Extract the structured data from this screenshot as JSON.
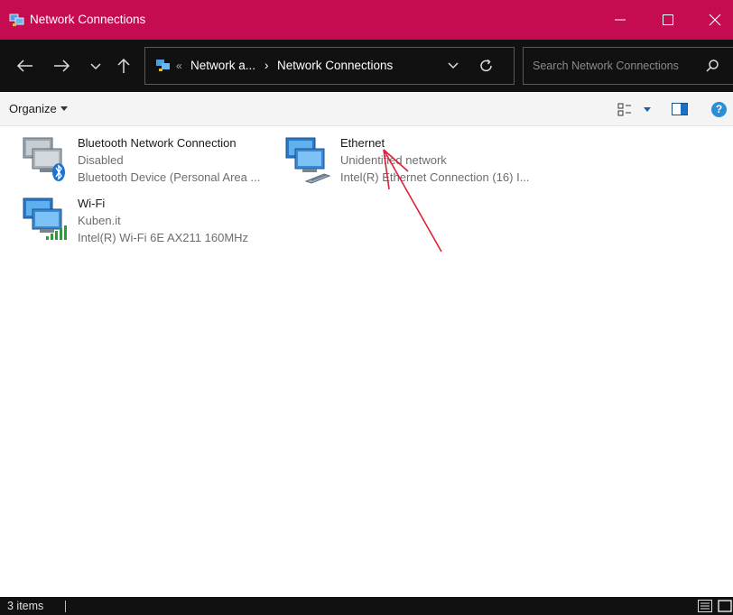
{
  "window": {
    "title": "Network Connections",
    "accent_color": "#c50c50",
    "controls": [
      "minimize-icon",
      "maximize-icon",
      "close-icon"
    ]
  },
  "navigation": {
    "back_icon": "arrow-left-icon",
    "forward_icon": "arrow-right-icon",
    "recent_icon": "chevron-down-icon",
    "up_icon": "arrow-up-icon",
    "address": {
      "overflow": "«",
      "crumb1": "Network a...",
      "separator": "›",
      "crumb2": "Network Connections"
    },
    "search_placeholder": "Search Network Connections"
  },
  "command_bar": {
    "organize_label": "Organize",
    "help_label": "?"
  },
  "items": [
    {
      "name": "Bluetooth Network Connection",
      "status": "Disabled",
      "device": "Bluetooth Device (Personal Area ...",
      "icon": "bluetooth-network-icon"
    },
    {
      "name": "Ethernet",
      "status": "Unidentified network",
      "device": "Intel(R) Ethernet Connection (16) I...",
      "icon": "ethernet-network-icon"
    },
    {
      "name": "Wi-Fi",
      "status": "Kuben.it",
      "device": "Intel(R) Wi-Fi 6E AX211 160MHz",
      "icon": "wifi-network-icon"
    }
  ],
  "annotation": {
    "color": "#e0203a",
    "icon": "red-arrow-annotation"
  },
  "status_bar": {
    "item_count": "3 items"
  }
}
